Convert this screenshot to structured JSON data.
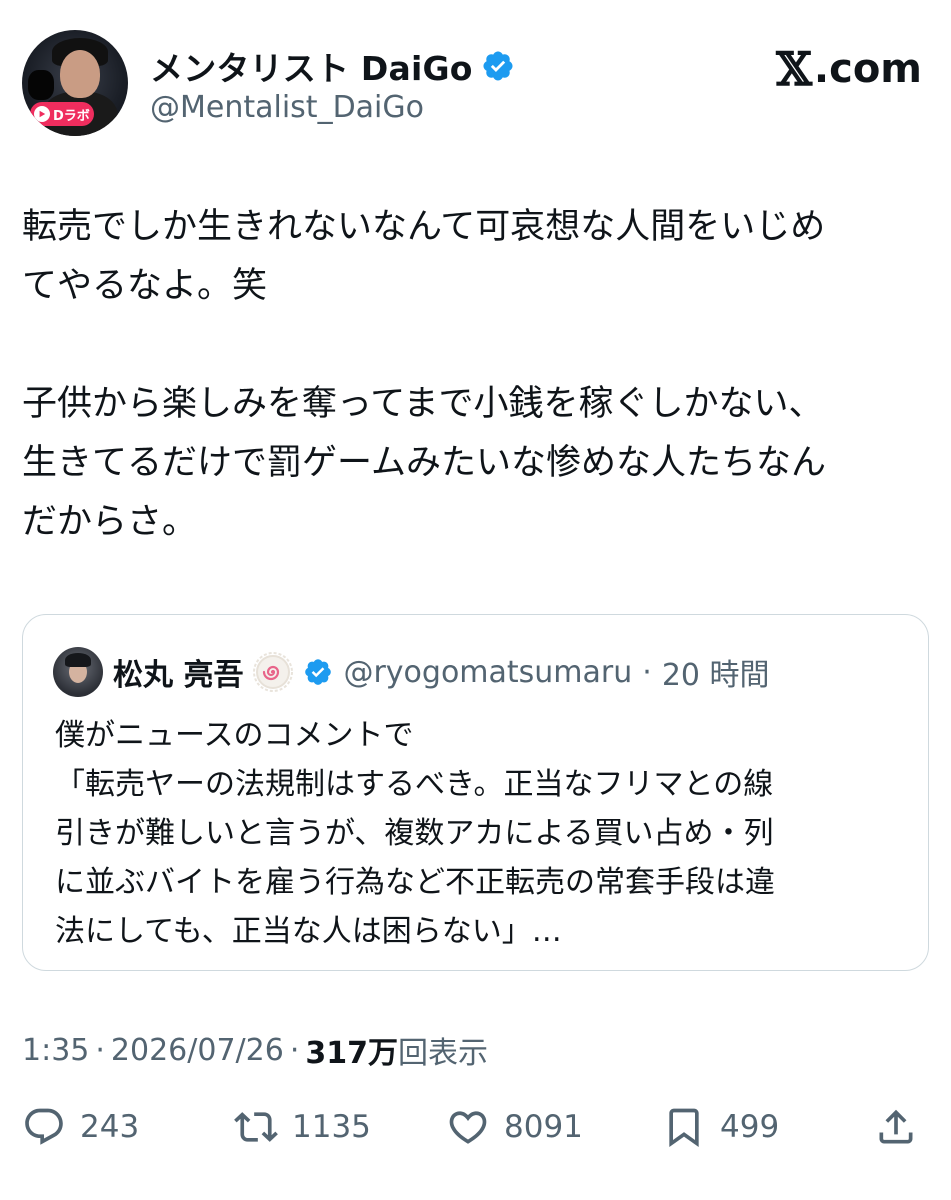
{
  "author": {
    "display_name": "メンタリスト DaiGo",
    "handle": "@Mentalist_DaiGo",
    "avatar_badge": "Dラボ"
  },
  "site_logo": {
    "mark": "𝕏",
    "text": ".com"
  },
  "tweet": {
    "text": "転売でしか生きれないなんて可哀想な人間をいじめ\nてやるなよ。笑\n\n子供から楽しみを奪ってまで小銭を稼ぐしかない、\n生きてるだけで罰ゲームみたいな惨めな人たちなん\nだからさ。"
  },
  "quote": {
    "display_name": "松丸 亮吾",
    "handle": "@ryogomatsumaru",
    "separator": "·",
    "time": "20 時間",
    "text": "僕がニュースのコメントで\n「転売ヤーの法規制はするべき。正当なフリマとの線\n引きが難しいと言うが、複数アカによる買い占め・列\nに並ぶバイトを雇う行為など不正転売の常套手段は違\n法にしても、正当な人は困らない」…"
  },
  "meta": {
    "time": "1:35",
    "dot1": "·",
    "date": "2026/07/26",
    "dot2": "·",
    "views_count": "317万",
    "views_label": "回表示"
  },
  "actions": {
    "replies": "243",
    "reposts": "1135",
    "likes": "8091",
    "bookmarks": "499"
  },
  "colors": {
    "text": "#0f1419",
    "secondary": "#536471",
    "verified": "#1d9bf0",
    "border": "#cfd9de"
  }
}
